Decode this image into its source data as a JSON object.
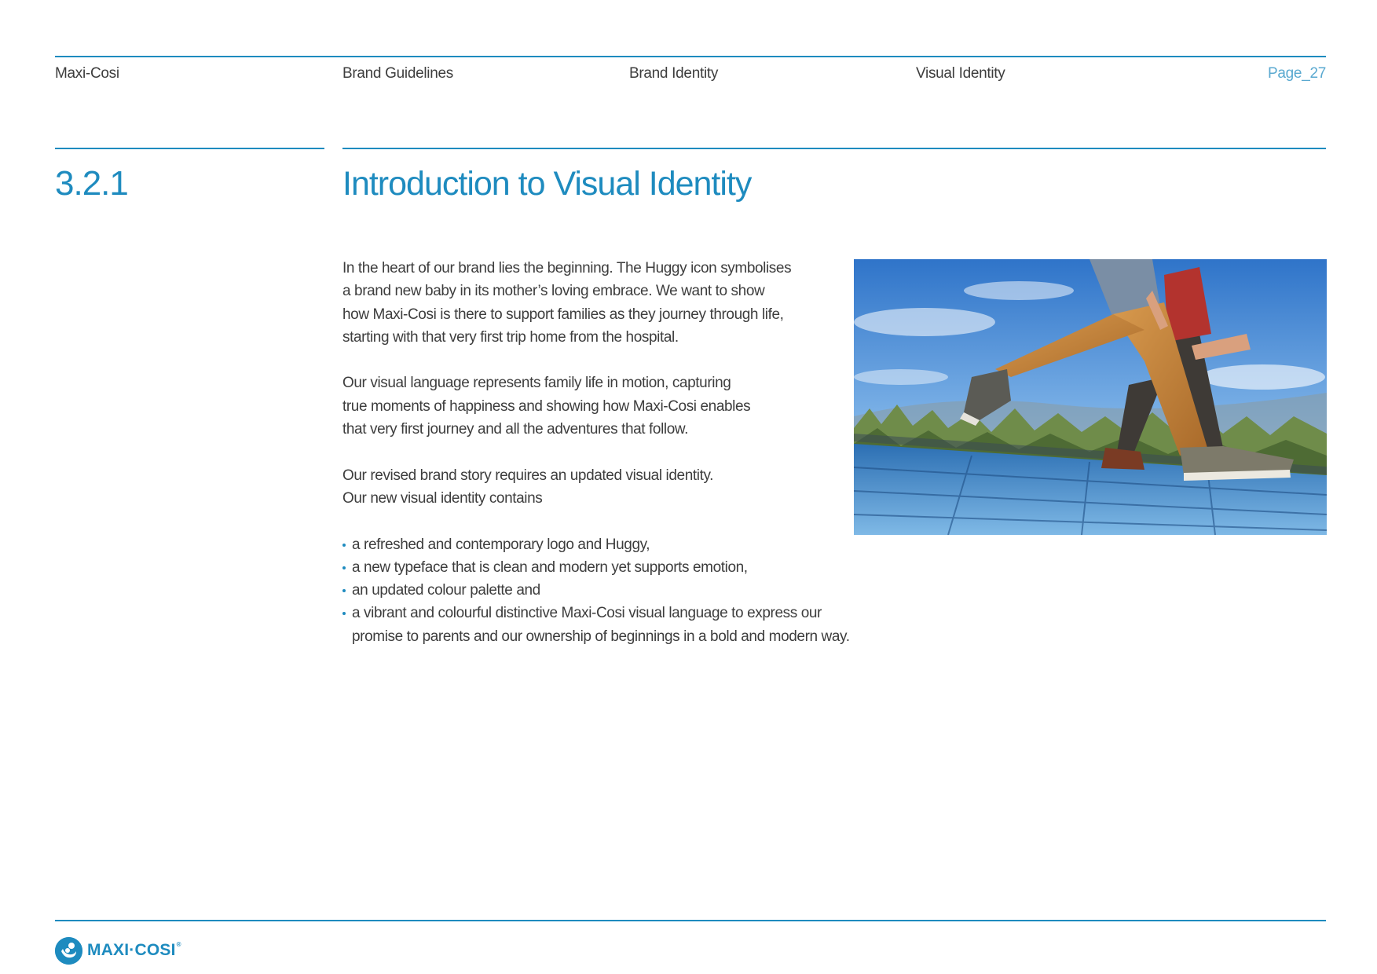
{
  "header": {
    "brand": "Maxi-Cosi",
    "guide": "Brand Guidelines",
    "chapter": "Brand Identity",
    "section": "Visual Identity",
    "page": "Page_27"
  },
  "section": {
    "number": "3.2.1",
    "title": "Introduction to Visual Identity"
  },
  "body": {
    "paragraphs": [
      "In the heart of our brand lies the beginning. The Huggy icon symbolises\na brand new baby in its mother’s loving embrace. We want to show\nhow Maxi-Cosi is there to support families as they journey through life,\nstarting with that very first trip home from the hospital.",
      "Our visual language represents family life in motion, capturing\ntrue moments of happiness and showing how Maxi-Cosi enables\nthat very first journey and all the adventures that follow.",
      "Our revised brand story requires an updated visual identity.\nOur new visual identity contains"
    ],
    "bullets": [
      "a refreshed and contemporary logo and Huggy,",
      "a new typeface that is clean and modern yet supports emotion,",
      "an updated colour palette and",
      "a vibrant and colourful distinctive Maxi-Cosi visual language to express our\npromise to parents and our ownership of beginnings in a bold and modern way."
    ]
  },
  "footer": {
    "logo_text": "MAXI·COSI",
    "logo_reg": "®"
  },
  "colors": {
    "accent": "#1e8bbf",
    "text": "#3d3d3d",
    "page_number": "#5aa9d0"
  }
}
